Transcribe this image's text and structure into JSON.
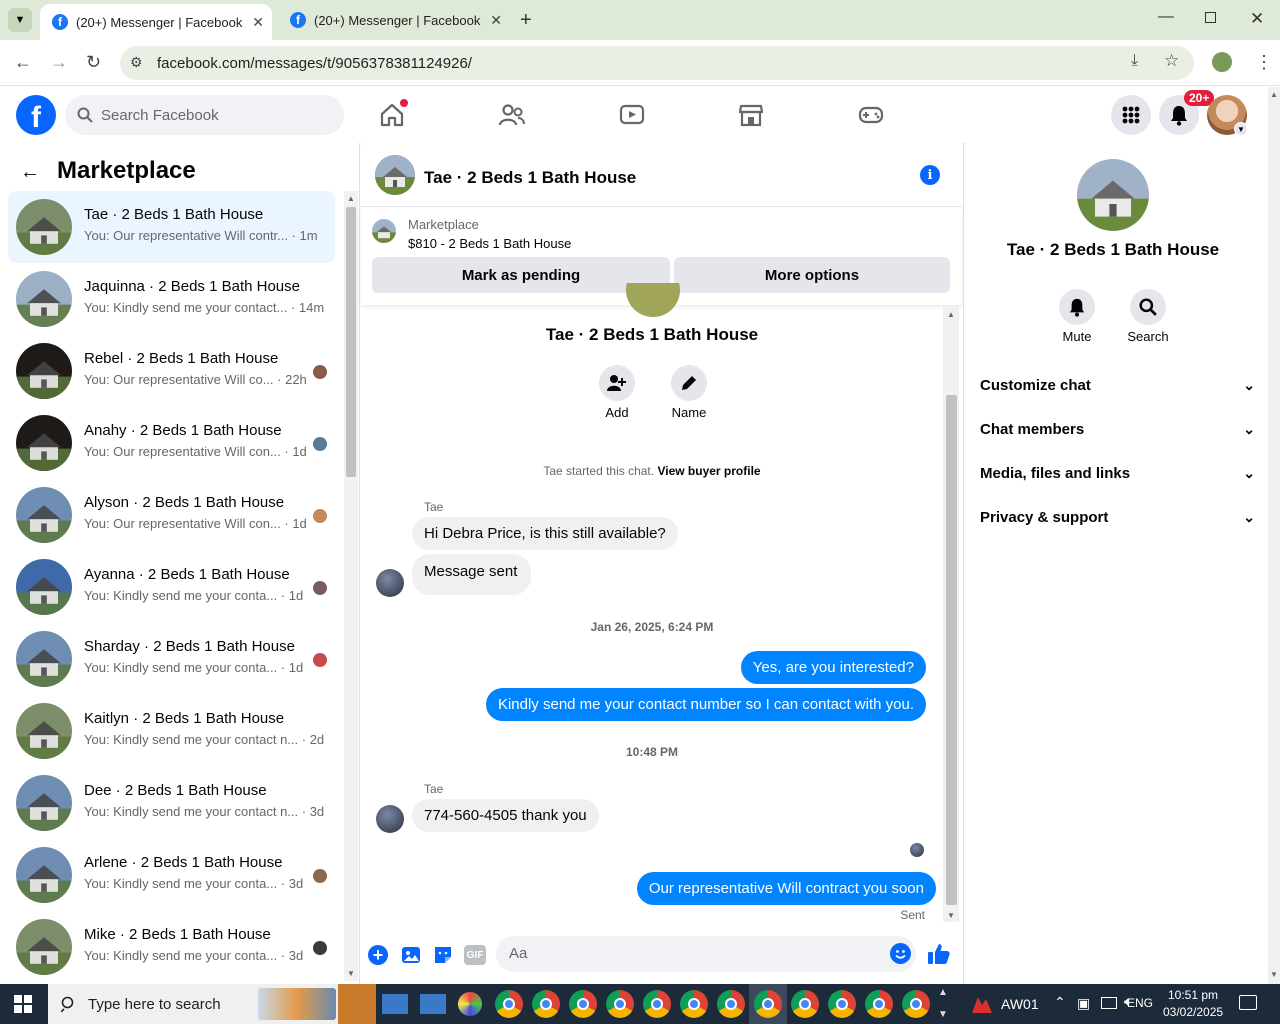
{
  "browser": {
    "tabs": [
      {
        "title": "(20+) Messenger | Facebook"
      },
      {
        "title": "(20+) Messenger | Facebook"
      }
    ],
    "url": "facebook.com/messages/t/9056378381124926/"
  },
  "fb_header": {
    "search_placeholder": "Search Facebook",
    "notifications_badge": "20+"
  },
  "left_panel": {
    "title": "Marketplace",
    "conversations": [
      {
        "name": "Tae · 2 Beds 1 Bath House",
        "preview": "You: Our representative Will contr... · 1m",
        "thumb_color": "#7d8f6a"
      },
      {
        "name": "Jaquinna · 2 Beds 1 Bath House",
        "preview": "You: Kindly send me your contact... · 14m",
        "thumb_color": "#9bb0c4"
      },
      {
        "name": "Rebel · 2 Beds 1 Bath House",
        "preview": "You: Our representative Will co... · 22h",
        "thumb_color": "#1e1a18"
      },
      {
        "name": "Anahy · 2 Beds 1 Bath House",
        "preview": "You: Our representative Will con... · 1d",
        "thumb_color": "#1e1a18"
      },
      {
        "name": "Alyson · 2 Beds 1 Bath House",
        "preview": "You: Our representative Will con... · 1d",
        "thumb_color": "#6f8db2"
      },
      {
        "name": "Ayanna · 2 Beds 1 Bath House",
        "preview": "You: Kindly send me your conta... · 1d",
        "thumb_color": "#3f6aa8"
      },
      {
        "name": "Sharday · 2 Beds 1 Bath House",
        "preview": "You: Kindly send me your conta... · 1d",
        "thumb_color": "#6f8db2"
      },
      {
        "name": "Kaitlyn · 2 Beds 1 Bath House",
        "preview": "You: Kindly send me your contact n... · 2d",
        "thumb_color": "#7d8f6a"
      },
      {
        "name": "Dee · 2 Beds 1 Bath House",
        "preview": "You: Kindly send me your contact n... · 3d",
        "thumb_color": "#6f8db2"
      },
      {
        "name": "Arlene · 2 Beds 1 Bath House",
        "preview": "You: Kindly send me your conta... · 3d",
        "thumb_color": "#6f8db2"
      },
      {
        "name": "Mike · 2 Beds 1 Bath House",
        "preview": "You: Kindly send me your conta... · 3d",
        "thumb_color": "#7d8f6a"
      }
    ]
  },
  "chat": {
    "title": "Tae · 2 Beds 1 Bath House",
    "listing_label": "Marketplace",
    "listing_detail": "$810 - 2 Beds 1 Bath House",
    "mark_pending": "Mark as pending",
    "more_options": "More options",
    "thread_name": "Tae · 2 Beds 1 Bath House",
    "add_label": "Add",
    "name_label": "Name",
    "started_text": "Tae started this chat.",
    "view_buyer": "View buyer profile",
    "sender1": "Tae",
    "msg1": "Hi Debra Price, is this still available?",
    "msg2": "Message sent",
    "ts1": "Jan 26, 2025, 6:24 PM",
    "msg3": "Yes, are you interested?",
    "msg4": "Kindly send me your contact number so I can contact with you.",
    "ts2": "10:48 PM",
    "sender2": "Tae",
    "msg5": "774-560-4505 thank you",
    "msg6": "Our representative Will contract you soon",
    "sent_status": "Sent",
    "composer_placeholder": "Aa"
  },
  "right_panel": {
    "title": "Tae · 2 Beds 1 Bath House",
    "mute": "Mute",
    "search": "Search",
    "sections": [
      "Customize chat",
      "Chat members",
      "Media, files and links",
      "Privacy & support"
    ]
  },
  "taskbar": {
    "search_placeholder": "Type here to search",
    "aw_label": "AW01",
    "language": "ENG",
    "time": "10:51 pm",
    "date": "03/02/2025"
  }
}
